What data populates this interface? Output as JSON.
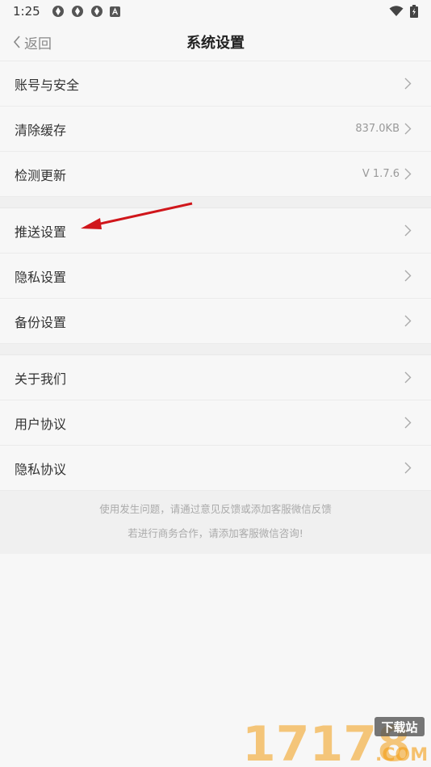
{
  "status": {
    "time": "1:25"
  },
  "nav": {
    "back_label": "返回",
    "title": "系统设置"
  },
  "groups": [
    [
      {
        "label": "账号与安全",
        "value": ""
      },
      {
        "label": "清除缓存",
        "value": "837.0KB"
      },
      {
        "label": "检测更新",
        "value": "V 1.7.6"
      }
    ],
    [
      {
        "label": "推送设置",
        "value": ""
      },
      {
        "label": "隐私设置",
        "value": ""
      },
      {
        "label": "备份设置",
        "value": ""
      }
    ],
    [
      {
        "label": "关于我们",
        "value": ""
      },
      {
        "label": "用户协议",
        "value": ""
      },
      {
        "label": "隐私协议",
        "value": ""
      }
    ]
  ],
  "footer": {
    "line1": "使用发生问题，请通过意见反馈或添加客服微信反馈",
    "line2": "若进行商务合作，请添加客服微信咨询!"
  },
  "watermark": {
    "number": "17178",
    "tag": "下载站",
    "domain": ".COM"
  },
  "colors": {
    "accent_arrow": "#d0161b",
    "watermark_orange": "#f39c12"
  }
}
